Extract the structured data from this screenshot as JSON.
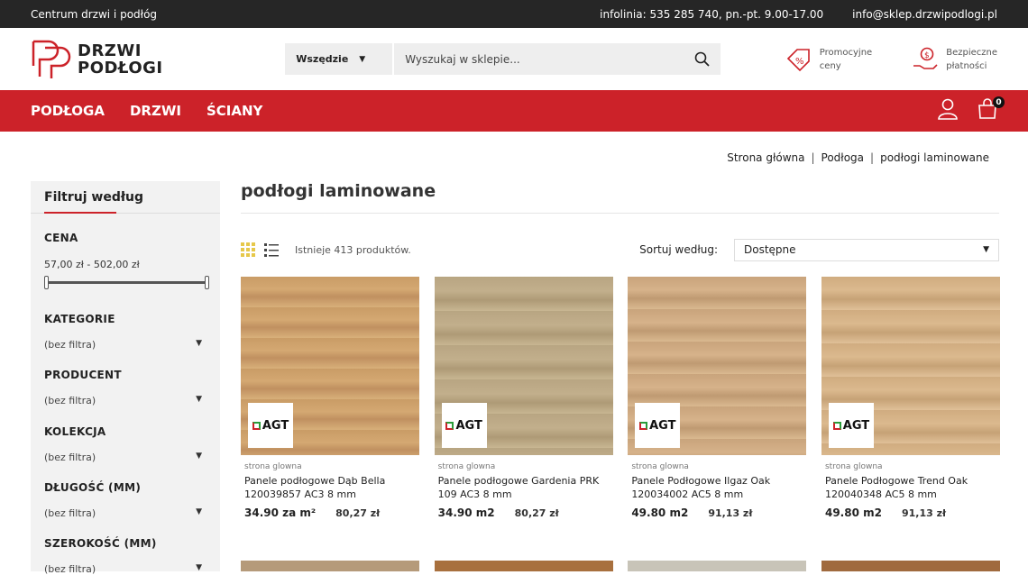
{
  "topbar": {
    "store_name": "Centrum drzwi i podłóg",
    "phone": "infolinia: 535 285 740, pn.-pt. 9.00-17.00",
    "email": "info@sklep.drzwipodlogi.pl"
  },
  "logo": {
    "line1": "DRZWI",
    "line2": "PODŁOGI"
  },
  "search": {
    "category": "Wszędzie",
    "placeholder": "Wyszukaj w sklepie..."
  },
  "features": [
    {
      "icon": "promo-tag-icon",
      "line1": "Promocyjne",
      "line2": "ceny"
    },
    {
      "icon": "secure-payment-icon",
      "line1": "Bezpieczne",
      "line2": "płatności"
    }
  ],
  "nav": {
    "items": [
      "PODŁOGA",
      "DRZWI",
      "ŚCIANY"
    ],
    "cart_count": "0"
  },
  "breadcrumb": [
    "Strona główna",
    "Podłoga",
    "podłogi laminowane"
  ],
  "sidebar": {
    "title": "Filtruj według",
    "price_label": "CENA",
    "price_range": "57,00 zł - 502,00 zł",
    "price_min_fraction": 0,
    "price_max_fraction": 1,
    "filters": [
      {
        "label": "KATEGORIE",
        "value": "(bez filtra)"
      },
      {
        "label": "PRODUCENT",
        "value": "(bez filtra)"
      },
      {
        "label": "KOLEKCJA",
        "value": "(bez filtra)"
      },
      {
        "label": "DŁUGOŚĆ (MM)",
        "value": "(bez filtra)"
      },
      {
        "label": "SZEROKOŚĆ (MM)",
        "value": "(bez filtra)"
      }
    ]
  },
  "main": {
    "title": "podłogi laminowane",
    "count": "Istnieje 413 produktów.",
    "sort_label": "Sortuj według:",
    "sort_value": "Dostępne"
  },
  "products": [
    {
      "category": "strona glowna",
      "name1": "Panele podłogowe Dąb Bella",
      "name2": "120039857 AC3 8 mm",
      "price": "34.90 za m²",
      "price2": "80,27 zł",
      "brand": "AGT"
    },
    {
      "category": "strona glowna",
      "name1": "Panele podłogowe Gardenia PRK",
      "name2": "109 AC3 8 mm",
      "price": "34.90 m2",
      "price2": "80,27 zł",
      "brand": "AGT"
    },
    {
      "category": "strona glowna",
      "name1": "Panele Podłogowe Ilgaz Oak",
      "name2": "120034002 AC5 8 mm",
      "price": "49.80 m2",
      "price2": "91,13 zł",
      "brand": "AGT"
    },
    {
      "category": "strona glowna",
      "name1": "Panele Podłogowe Trend Oak",
      "name2": "120040348 AC5 8 mm",
      "price": "49.80 m2",
      "price2": "91,13 zł",
      "brand": "AGT"
    }
  ],
  "colors": {
    "brand_red": "#cc2229",
    "topbar": "#262626"
  }
}
